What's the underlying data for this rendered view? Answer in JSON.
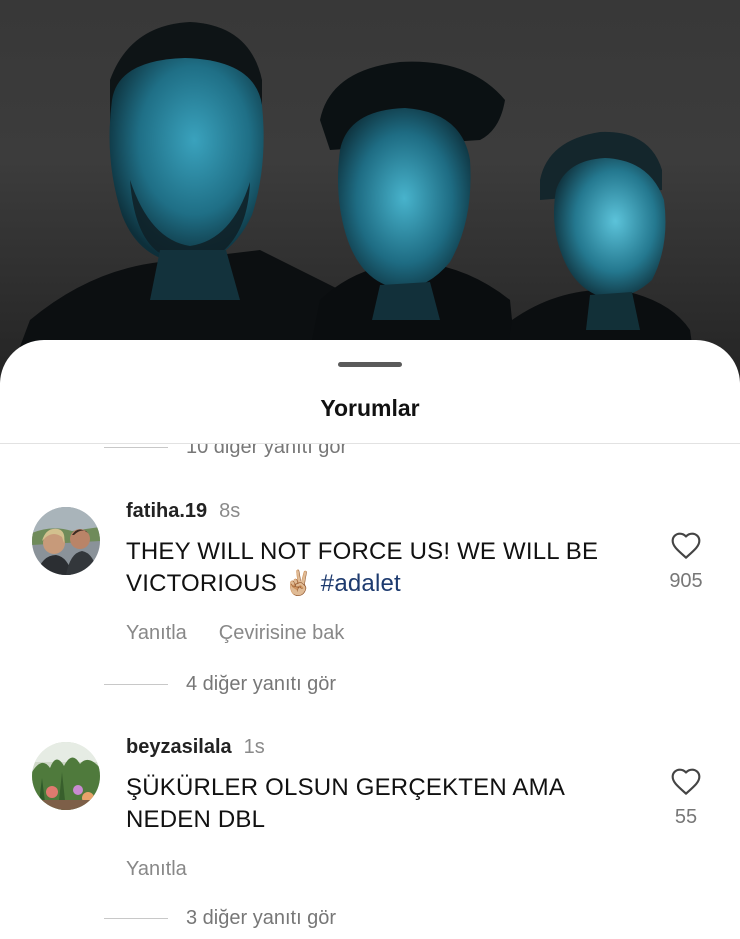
{
  "sheet": {
    "title": "Yorumlar"
  },
  "top_more_replies": "10 diğer yanıtı gör",
  "comments": [
    {
      "username": "fatiha.19",
      "time": "8s",
      "text": "THEY WILL NOT FORCE US! WE WILL BE VICTORIOUS",
      "emoji": "✌🏼",
      "hashtag": "#adalet",
      "likes": "905",
      "actions": [
        "Yanıtla",
        "Çevirisine bak"
      ],
      "more_replies": "4 diğer yanıtı gör"
    },
    {
      "username": "beyzasilala",
      "time": "1s",
      "text": "ŞÜKÜRLER OLSUN GERÇEKTEN AMA NEDEN DBL",
      "likes": "55",
      "actions": [
        "Yanıtla"
      ],
      "more_replies": "3 diğer yanıtı gör"
    }
  ],
  "colors": {
    "hashtag": "#1d3a6e",
    "sheet_bg": "#ffffff",
    "photo_tint": "#1f6f86"
  },
  "icons": {
    "like": "heart-outline-icon"
  }
}
